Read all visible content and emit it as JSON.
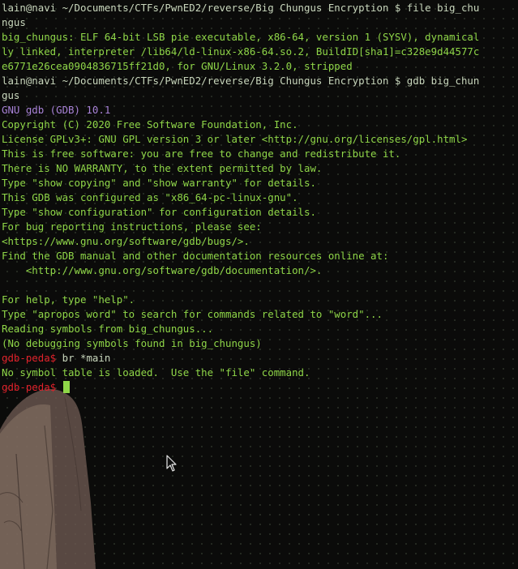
{
  "terminal": {
    "lines": [
      {
        "kind": "prompt",
        "text": "lain@navi ~/Documents/CTFs/PwnED2/reverse/Big Chungus Encryption $ file big_chu"
      },
      {
        "kind": "prompt",
        "text": "ngus"
      },
      {
        "kind": "output",
        "text": "big_chungus: ELF 64-bit LSB pie executable, x86-64, version 1 (SYSV), dynamical"
      },
      {
        "kind": "output",
        "text": "ly linked, interpreter /lib64/ld-linux-x86-64.so.2, BuildID[sha1]=c328e9d44577c"
      },
      {
        "kind": "output",
        "text": "e6771e26cea0904836715ff21d0, for GNU/Linux 3.2.0, stripped"
      },
      {
        "kind": "prompt",
        "text": "lain@navi ~/Documents/CTFs/PwnED2/reverse/Big Chungus Encryption $ gdb big_chun"
      },
      {
        "kind": "prompt",
        "text": "gus"
      },
      {
        "kind": "header",
        "text": "GNU gdb (GDB) 10.1"
      },
      {
        "kind": "output",
        "text": "Copyright (C) 2020 Free Software Foundation, Inc."
      },
      {
        "kind": "output",
        "text": "License GPLv3+: GNU GPL version 3 or later <http://gnu.org/licenses/gpl.html>"
      },
      {
        "kind": "output",
        "text": "This is free software: you are free to change and redistribute it."
      },
      {
        "kind": "output",
        "text": "There is NO WARRANTY, to the extent permitted by law."
      },
      {
        "kind": "output",
        "text": "Type \"show copying\" and \"show warranty\" for details."
      },
      {
        "kind": "output",
        "text": "This GDB was configured as \"x86_64-pc-linux-gnu\"."
      },
      {
        "kind": "output",
        "text": "Type \"show configuration\" for configuration details."
      },
      {
        "kind": "output",
        "text": "For bug reporting instructions, please see:"
      },
      {
        "kind": "output",
        "text": "<https://www.gnu.org/software/gdb/bugs/>."
      },
      {
        "kind": "output",
        "text": "Find the GDB manual and other documentation resources online at:"
      },
      {
        "kind": "output",
        "text": "    <http://www.gnu.org/software/gdb/documentation/>."
      },
      {
        "kind": "output",
        "text": ""
      },
      {
        "kind": "output",
        "text": "For help, type \"help\"."
      },
      {
        "kind": "output",
        "text": "Type \"apropos word\" to search for commands related to \"word\"..."
      },
      {
        "kind": "output",
        "text": "Reading symbols from big_chungus..."
      },
      {
        "kind": "output",
        "text": "(No debugging symbols found in big_chungus)"
      },
      {
        "kind": "gdb",
        "prompt": "gdb-peda$ ",
        "text": "br *main"
      },
      {
        "kind": "output",
        "text": "No symbol table is loaded.  Use the \"file\" command."
      },
      {
        "kind": "gdb-active",
        "prompt": "gdb-peda$ ",
        "text": ""
      }
    ]
  },
  "colors": {
    "background": "#0b0b0a",
    "output_green": "#8fd648",
    "prompt_text": "#c8d6bc",
    "gdb_header_purple": "#a983d8",
    "gdb_prompt_red": "#e0222b",
    "cursor": "#8fd648"
  },
  "icons": {
    "mouse": "mouse-pointer-icon",
    "wallpaper": "anime-character-wallpaper"
  }
}
